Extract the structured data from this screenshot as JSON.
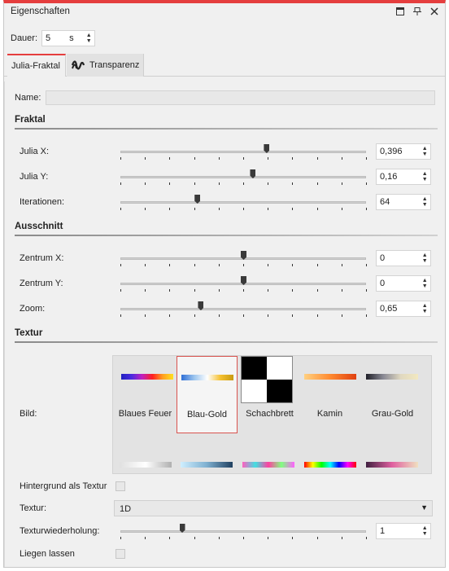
{
  "window": {
    "title": "Eigenschaften",
    "icons": [
      "window-icon",
      "pin-icon",
      "close-icon"
    ],
    "accent_color": "#e53e3e"
  },
  "dauer": {
    "label": "Dauer:",
    "value": "5",
    "unit": "s"
  },
  "tabs": [
    {
      "label": "Julia-Fraktal",
      "active": true
    },
    {
      "label": "Transparenz",
      "active": false,
      "icon": "transparency-wave-icon"
    }
  ],
  "name": {
    "label": "Name:",
    "value": ""
  },
  "sections": {
    "fraktal": "Fraktal",
    "ausschnitt": "Ausschnitt",
    "textur": "Textur"
  },
  "fraktal": [
    {
      "label": "Julia X:",
      "value": "0,396",
      "position": 0.594
    },
    {
      "label": "Julia Y:",
      "value": "0,16",
      "position": 0.538
    },
    {
      "label": "Iterationen:",
      "value": "64",
      "position": 0.312
    }
  ],
  "ausschnitt": [
    {
      "label": "Zentrum X:",
      "value": "0",
      "position": 0.5
    },
    {
      "label": "Zentrum Y:",
      "value": "0",
      "position": 0.5
    },
    {
      "label": "Zoom:",
      "value": "0,65",
      "position": 0.326
    }
  ],
  "textur": {
    "bild_label": "Bild:",
    "selected": "Blau-Gold",
    "items": [
      {
        "name": "Blaues Feuer",
        "gradient": "linear-gradient(to right,#2020c0,#4a2be0,#c020c0,#ff2020,#ffa020,#ffe020)"
      },
      {
        "name": "Blau-Gold",
        "gradient": "linear-gradient(to right,#2f6fd6,#9ec6ee,#ffffff,#f5c030,#c89a10)"
      },
      {
        "name": "Schachbrett",
        "gradient": ""
      },
      {
        "name": "Kamin",
        "gradient": "linear-gradient(to right,#ffd080,#ff8a30,#e04010)"
      },
      {
        "name": "Grau-Gold",
        "gradient": "linear-gradient(to right,#202028,#8a8a95,#e0d8c0,#f2e8c0)"
      }
    ],
    "second_row": [
      "linear-gradient(to right,#e0e0e0,#ffffff,#b0b0b0)",
      "linear-gradient(to right,#cfefff,#7fb0d0,#204060)",
      "linear-gradient(to right,#ff60c0,#40e0e0,#ff40a0,#80ff80,#ff60ff)",
      "linear-gradient(to right,#ff0000,#ffff00,#00ff00,#00ffff,#0000ff,#ff00ff,#ff0000)",
      "linear-gradient(to right,#402040,#e060a0,#f0e0c0)"
    ],
    "hintergrund_label": "Hintergrund als Textur",
    "textur_label": "Textur:",
    "textur_value": "1D",
    "wiederholung_label": "Texturwiederholung:",
    "wiederholung_value": "1",
    "wiederholung_position": 0.25,
    "liegen_label": "Liegen lassen"
  }
}
